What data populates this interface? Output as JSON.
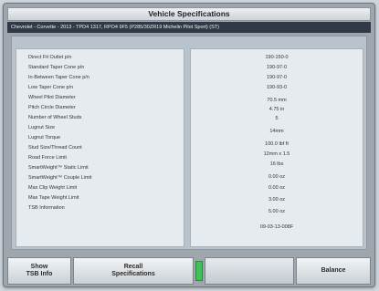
{
  "header": {
    "title": "Vehicle Specifications",
    "vehicle": "Chevrolet - Corvette - 2013 - TPD4 1317, RPO4 9F5 (P285/30ZR19 Michelin Pilot Sport) (ST)"
  },
  "specs": [
    {
      "label": "Direct Fit Outlet p/n",
      "value": "190-150-0"
    },
    {
      "label": "Standard Taper Cone p/n",
      "value": "190-97-0"
    },
    {
      "label": "In-Between Taper Cone p/n",
      "value": "190-97-0"
    },
    {
      "label": "Low Taper Cone p/n",
      "value": "190-93-0"
    },
    {
      "label": "Wheel Pilot Diameter",
      "value": ""
    },
    {
      "label": "Pitch Circle Diameter",
      "value": "70.5 mm"
    },
    {
      "label": "Number of Wheel Studs",
      "value": "4.75 in"
    },
    {
      "label": "Lugnut Size",
      "value": "5"
    },
    {
      "label": "Lugnut Torque",
      "value": "14mm"
    },
    {
      "label": "Stud Size/Thread Count",
      "value": "100.0 lbf ft"
    },
    {
      "label": "Road Force Limit",
      "value": "12mm x 1.5"
    },
    {
      "label": "SmartWeight™ Static Limit",
      "value": "16 lbs"
    },
    {
      "label": "SmartWeight™ Couple Limit",
      "value": "0.00 oz"
    },
    {
      "label": "Max Clip Weight Limit",
      "value": "0.00 oz"
    },
    {
      "label": "Max Tape Weight Limit",
      "value": "3.00 oz"
    },
    {
      "label": "TSB Information",
      "value": "5.00 oz"
    },
    {
      "label": "",
      "value": "09-03-13-008F"
    }
  ],
  "footer": {
    "show_tsb": {
      "line1": "Show",
      "line2": "TSB Info"
    },
    "recall": {
      "line1": "Recall",
      "line2": "Specifications"
    },
    "balance": "Balance"
  }
}
